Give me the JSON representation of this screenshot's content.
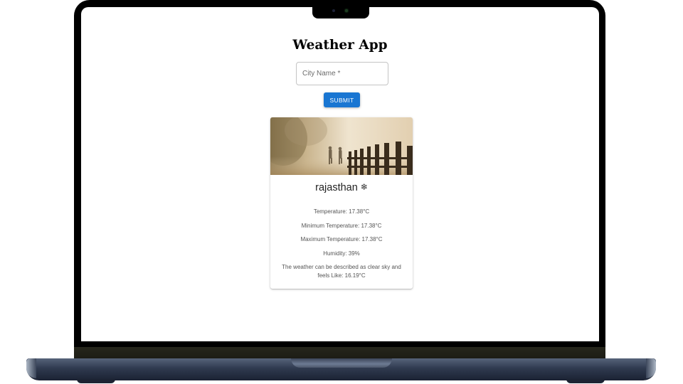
{
  "app": {
    "title": "Weather App",
    "city_input_placeholder": "City Name *",
    "submit_label": "SUBMIT"
  },
  "result": {
    "city": "rajasthan",
    "icon": "snowflake-sun-icon",
    "temperature": "Temperature: 17.38°C",
    "min_temperature": "Minimum Temperature: 17.38°C",
    "max_temperature": "Maximum Temperature: 17.38°C",
    "humidity": "Humidity: 39%",
    "description": "The weather can be described as clear sky and feels Like: 16.19°C"
  },
  "colors": {
    "accent": "#1976d2",
    "frame": "#000000",
    "base": "#2f3a4f"
  }
}
